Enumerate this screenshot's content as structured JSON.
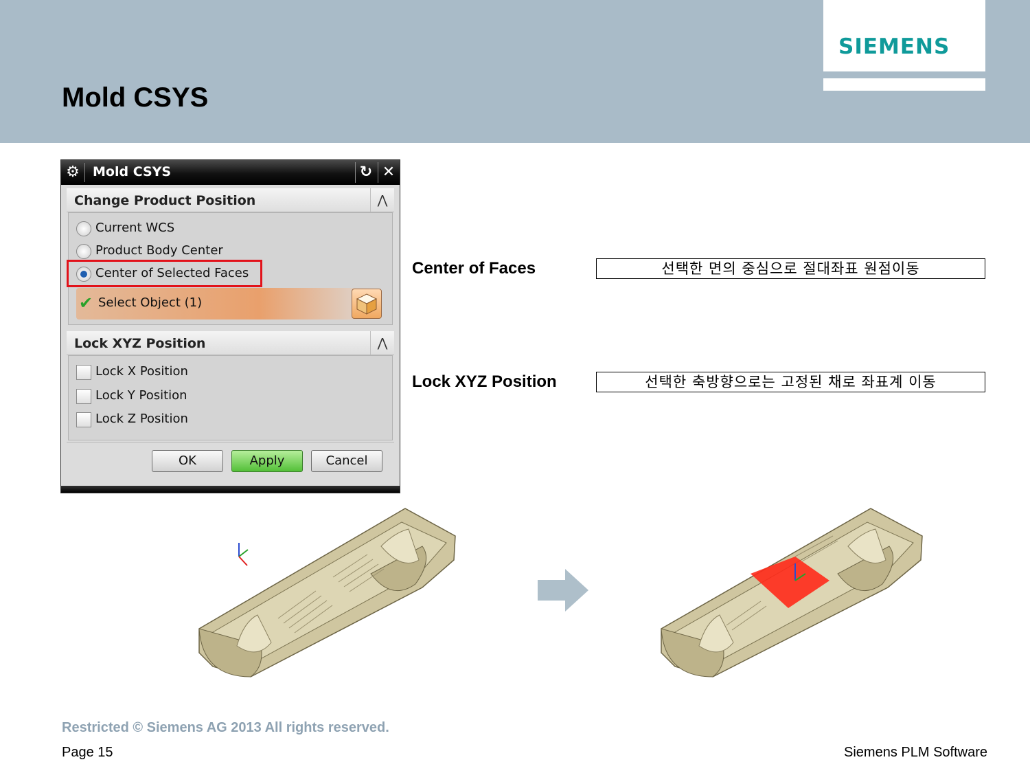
{
  "header": {
    "title": "Mold CSYS",
    "logo": "SIEMENS"
  },
  "dialog": {
    "title": "Mold CSYS",
    "icons": {
      "settings": "gear-icon",
      "reset": "reset-icon",
      "close": "close-icon"
    },
    "change_position": {
      "label": "Change Product Position",
      "options": [
        {
          "label": "Current WCS",
          "selected": false
        },
        {
          "label": "Product Body Center",
          "selected": false
        },
        {
          "label": "Center of Selected Faces",
          "selected": true
        }
      ],
      "select_object": "Select Object (1)"
    },
    "lock_position": {
      "label": "Lock XYZ Position",
      "options": [
        {
          "label": "Lock X Position",
          "checked": false
        },
        {
          "label": "Lock Y Position",
          "checked": false
        },
        {
          "label": "Lock Z Position",
          "checked": false
        }
      ]
    },
    "buttons": {
      "ok": "OK",
      "apply": "Apply",
      "cancel": "Cancel"
    }
  },
  "descriptions": [
    {
      "label": "Center of Faces",
      "text": "선택한 면의 중심으로 절대좌표 원점이동"
    },
    {
      "label": "Lock XYZ Position",
      "text": "선택한 축방향으로는 고정된 채로 좌표계 이동"
    }
  ],
  "footer": {
    "copyright": "Restricted © Siemens AG 2013 All rights reserved.",
    "page": "Page 15",
    "company": "Siemens PLM Software"
  },
  "colors": {
    "header_band": "#a9bbc8",
    "logo": "#0f9a9a",
    "highlight": "#e2121a",
    "apply": "#53c038",
    "selected_face": "#ff2a1a",
    "part": "#cbc29c"
  }
}
